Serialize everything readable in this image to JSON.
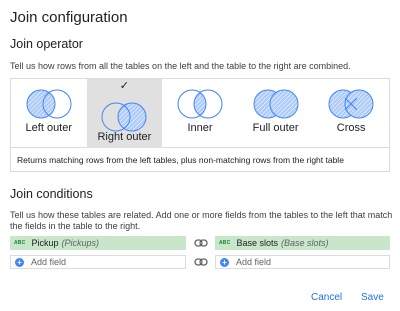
{
  "dialog": {
    "title": "Join configuration"
  },
  "operator": {
    "heading": "Join operator",
    "description": "Tell us how rows from all the tables on the left and the table to the right are combined.",
    "options": [
      {
        "label": "Left outer"
      },
      {
        "label": "Right outer"
      },
      {
        "label": "Inner"
      },
      {
        "label": "Full outer"
      },
      {
        "label": "Cross"
      }
    ],
    "selected": "Right outer",
    "note": "Returns matching rows from the left tables, plus non-matching rows from the right table"
  },
  "conditions": {
    "heading": "Join conditions",
    "description": "Tell us how these tables are related. Add one or more fields from the tables to the left that match the fields in the table to the right.",
    "left_field": {
      "type_badge": "ABC",
      "name": "Pickup",
      "source": "(Pickups)"
    },
    "right_field": {
      "type_badge": "ABC",
      "name": "Base slots",
      "source": "(Base slots)"
    },
    "add_field_label": "Add field",
    "add_field_label_right": "Add field"
  },
  "actions": {
    "cancel": "Cancel",
    "save": "Save"
  },
  "colors": {
    "accent": "#1a73e8",
    "venn_fill": "#aecbfa",
    "venn_stroke": "#4285f4",
    "field_bg": "#c8e6c9"
  }
}
